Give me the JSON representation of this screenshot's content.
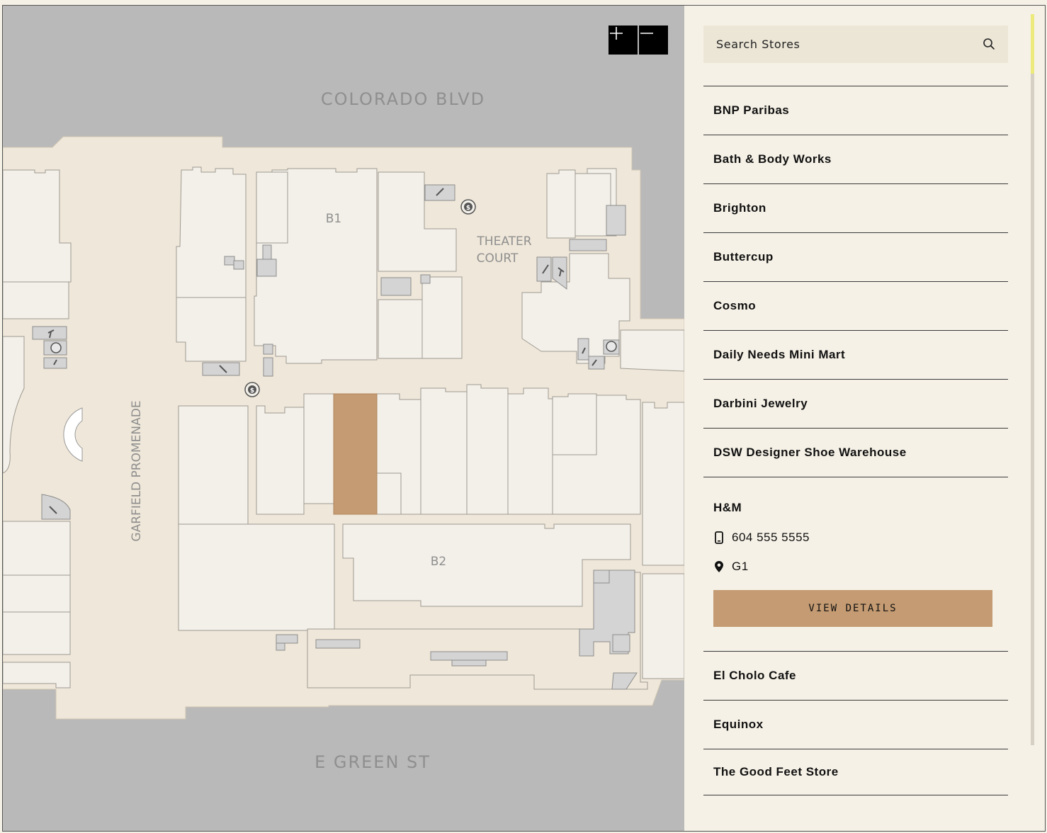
{
  "map": {
    "street_top": "COLORADO BLVD",
    "street_bottom": "E GREEN ST",
    "promenade": "GARFIELD PROMENADE",
    "court_line1": "THEATER",
    "court_line2": "COURT",
    "building_b1": "B1",
    "building_b2": "B2",
    "colors": {
      "street": "#b9b9b9",
      "walkway": "#efe7d9",
      "store": "#f3f0e9",
      "service": "#d4d4d4",
      "highlight": "#c49b72"
    },
    "zoom_in_icon": "plus-icon",
    "zoom_out_icon": "minus-icon"
  },
  "search": {
    "placeholder": "Search Stores",
    "icon": "search-icon"
  },
  "stores_before": [
    "BNP Paribas",
    "Bath & Body Works",
    "Brighton",
    "Buttercup",
    "Cosmo",
    "Daily Needs Mini Mart",
    "Darbini Jewelry",
    "DSW Designer Shoe Warehouse"
  ],
  "selected": {
    "name": "H&M",
    "phone": "604 555 5555",
    "location": "G1",
    "button": "VIEW DETAILS",
    "phone_icon": "mobile-phone-icon",
    "location_icon": "map-pin-icon"
  },
  "stores_after": [
    "El Cholo Cafe",
    "Equinox",
    "The Good Feet Store"
  ]
}
